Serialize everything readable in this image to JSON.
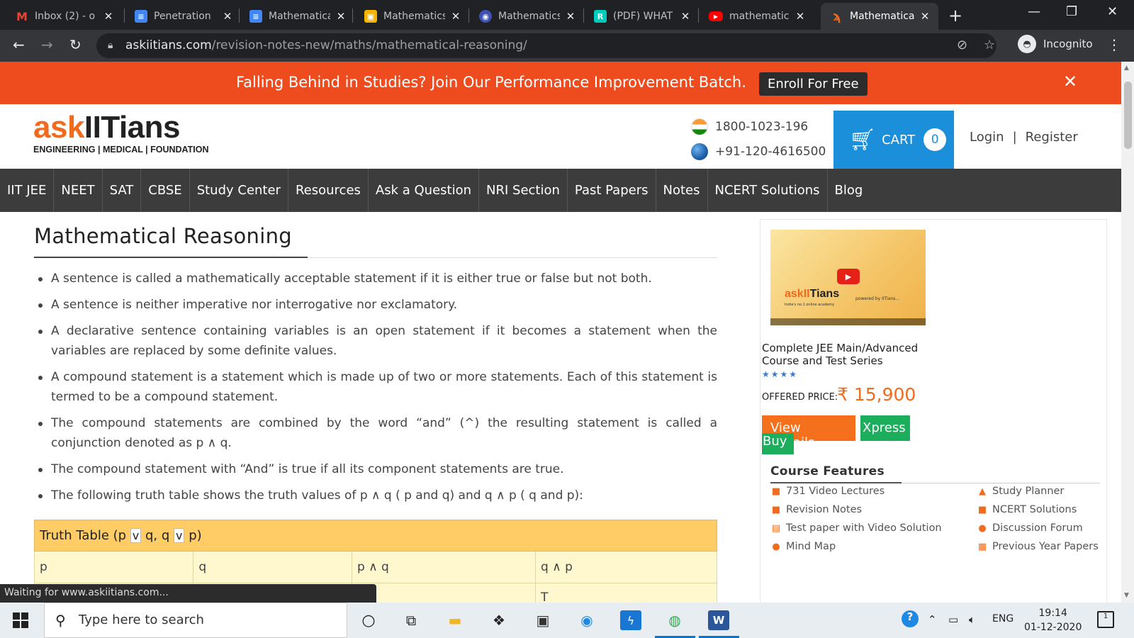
{
  "browser": {
    "tabs": [
      {
        "title": "Inbox (2) - o",
        "icon": "gmail-icon",
        "color": "#ea4335",
        "glyph": "M",
        "active": false
      },
      {
        "title": "Penetration",
        "icon": "google-docs-icon",
        "color": "#4285f4",
        "glyph": "≡",
        "active": false
      },
      {
        "title": "Mathematica",
        "icon": "google-docs-icon",
        "color": "#4285f4",
        "glyph": "≡",
        "active": false
      },
      {
        "title": "Mathematics",
        "icon": "slides-icon",
        "color": "#f4b400",
        "glyph": "▣",
        "active": false
      },
      {
        "title": "Mathematics",
        "icon": "globe-icon",
        "color": "#3f51b5",
        "glyph": "◉",
        "active": false
      },
      {
        "title": "(PDF) WHAT",
        "icon": "researchgate-icon",
        "color": "#00ccbb",
        "glyph": "R",
        "active": false
      },
      {
        "title": "mathematica",
        "icon": "youtube-icon",
        "color": "#ff0000",
        "glyph": "▶",
        "active": false
      },
      {
        "title": "Mathematica",
        "icon": "askiitians-icon",
        "color": "#f06b1d",
        "glyph": "ϡ",
        "active": true
      }
    ],
    "url_host": "askiitians.com",
    "url_path": "/revision-notes-new/maths/mathematical-reasoning/",
    "profile_label": "Incognito"
  },
  "promo": {
    "text": "Falling Behind in Studies? Join Our Performance Improvement Batch.",
    "button": "Enroll For Free"
  },
  "header": {
    "logo_ask": "ask",
    "logo_rest": "IITians",
    "logo_sub": "ENGINEERING | MEDICAL | FOUNDATION",
    "phone1": "1800-1023-196",
    "phone2": "+91-120-4616500",
    "cart_label": "CART",
    "cart_count": "0",
    "login": "Login",
    "separator": "|",
    "register": "Register"
  },
  "nav": [
    "IIT JEE",
    "NEET",
    "SAT",
    "CBSE",
    "Study Center",
    "Resources",
    "Ask a Question",
    "NRI Section",
    "Past Papers",
    "Notes",
    "NCERT Solutions",
    "Blog"
  ],
  "article": {
    "title": "Mathematical Reasoning",
    "bullets": [
      "A sentence is called a mathematically acceptable statement if it is either true or false but not both.",
      "A sentence is neither imperative nor interrogative nor exclamatory.",
      "A declarative sentence containing variables is an open statement if it becomes a statement when the variables are replaced by some definite values.",
      "A compound statement is a statement which is made up of two or more statements. Each of this statement is termed to be a compound statement.",
      "The compound statements are combined by the word “and” (^) the resulting statement is called a conjunction denoted as p ∧ q.",
      "The compound statement with “And” is true if all its component statements are true.",
      "The following truth table shows the truth values of p ∧ q ( p and q) and q ∧ p ( q and p):"
    ],
    "table": {
      "caption_a": "Truth Table (p ",
      "caption_v1": "v",
      "caption_b": " q, q ",
      "caption_v2": "v",
      "caption_c": " p)",
      "headers": [
        "p",
        "q",
        "p ∧ q",
        "q ∧ p"
      ],
      "partial_row_last": "T"
    }
  },
  "sidebar": {
    "video_brand_a": "askII",
    "video_brand_b": "Tians",
    "video_powered": "powered by IITians...",
    "video_tagline": "India's no.1 online academy",
    "course_title": "Complete JEE Main/Advanced Course and Test Series",
    "stars": "★★★★",
    "price_label": "OFFERED PRICE:",
    "price": "₹ 15,900",
    "view_button": "View Details",
    "xpress_button": "Xpress",
    "buy_button": "Buy",
    "features_title": "Course Features",
    "features": [
      {
        "label": "731 Video Lectures",
        "icon": "video-icon"
      },
      {
        "label": "Study Planner",
        "icon": "graduation-cap-icon"
      },
      {
        "label": "Revision Notes",
        "icon": "notes-icon"
      },
      {
        "label": "NCERT Solutions",
        "icon": "book-icon"
      },
      {
        "label": "Test paper with Video Solution",
        "icon": "test-paper-icon"
      },
      {
        "label": "Discussion Forum",
        "icon": "chat-icon"
      },
      {
        "label": "Mind Map",
        "icon": "map-pin-icon"
      },
      {
        "label": "Previous Year Papers",
        "icon": "calendar-icon"
      }
    ]
  },
  "status_bar": "Waiting for www.askiitians.com...",
  "taskbar": {
    "search_placeholder": "Type here to search",
    "language": "ENG",
    "time": "19:14",
    "date": "01-12-2020",
    "notifications": "1"
  }
}
